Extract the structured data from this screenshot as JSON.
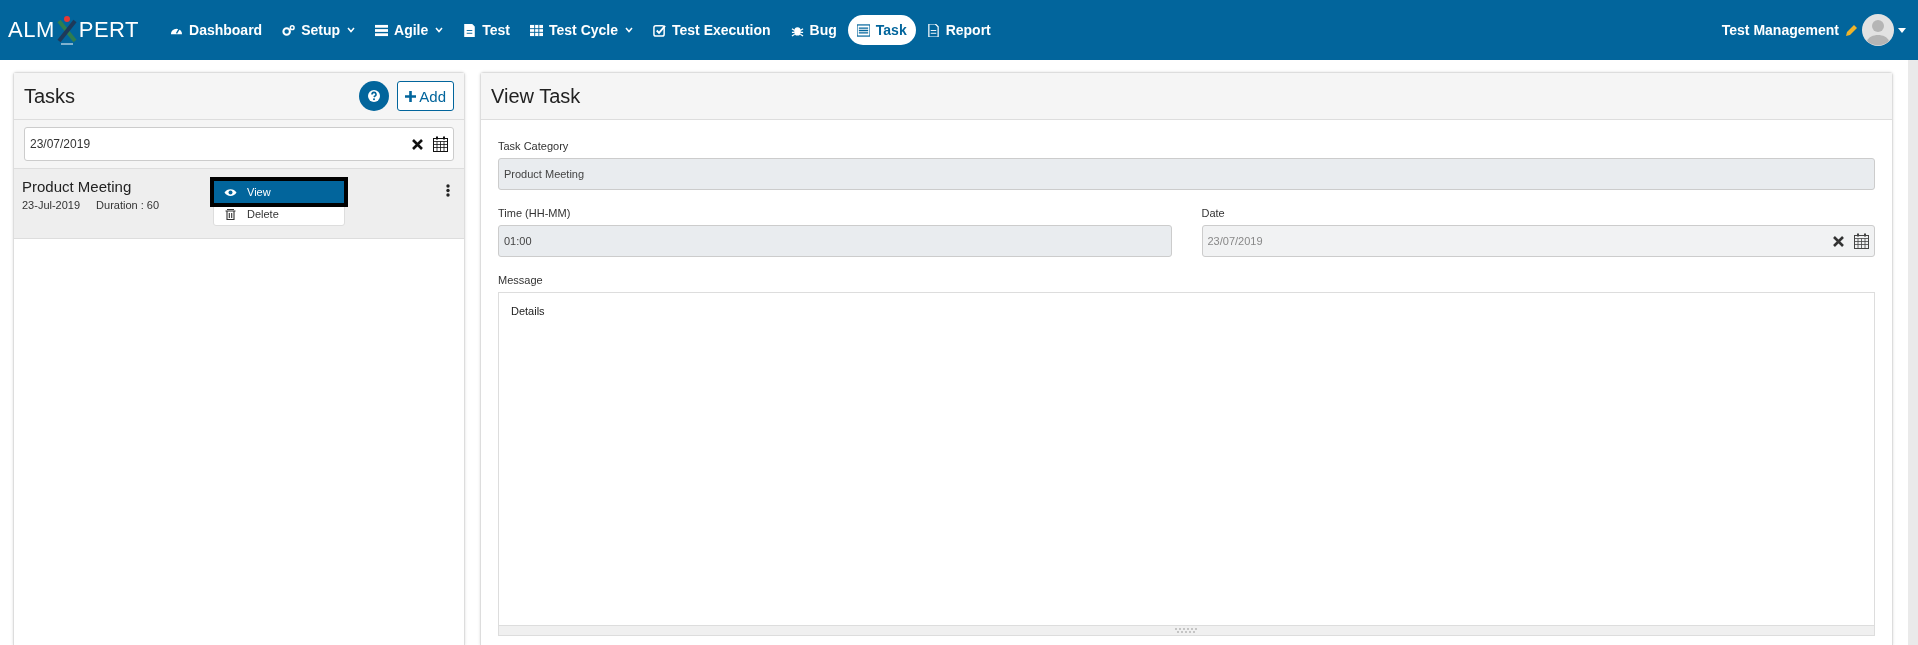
{
  "navbar": {
    "brand": {
      "left": "ALM",
      "right": "PERT"
    },
    "items": [
      {
        "label": "Dashboard",
        "has_menu": false,
        "selected": false
      },
      {
        "label": "Setup",
        "has_menu": true,
        "selected": false
      },
      {
        "label": "Agile",
        "has_menu": true,
        "selected": false
      },
      {
        "label": "Test",
        "has_menu": false,
        "selected": false
      },
      {
        "label": "Test Cycle",
        "has_menu": true,
        "selected": false
      },
      {
        "label": "Test Execution",
        "has_menu": false,
        "selected": false
      },
      {
        "label": "Bug",
        "has_menu": false,
        "selected": false
      },
      {
        "label": "Task",
        "has_menu": false,
        "selected": true
      },
      {
        "label": "Report",
        "has_menu": false,
        "selected": false
      }
    ],
    "user": "Test Management"
  },
  "tasks_panel": {
    "title": "Tasks",
    "add_button": "Add",
    "date_filter": "23/07/2019",
    "tasks": [
      {
        "title": "Product Meeting",
        "date": "23-Jul-2019",
        "duration": "Duration : 60",
        "menu_open": true
      }
    ],
    "menu": [
      {
        "label": "View",
        "selected": true
      },
      {
        "label": "Delete",
        "selected": false
      }
    ]
  },
  "view_panel": {
    "title": "View Task",
    "category": {
      "label": "Task Category",
      "value": "Product Meeting"
    },
    "time": {
      "label": "Time (HH-MM)",
      "value": "01:00"
    },
    "date": {
      "label": "Date",
      "value": "23/07/2019"
    },
    "message": {
      "label": "Message",
      "value": "Details"
    }
  }
}
